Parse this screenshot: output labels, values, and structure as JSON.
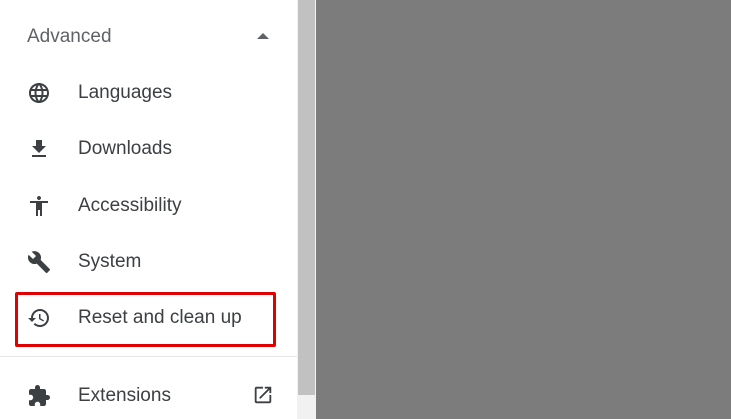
{
  "sidebar": {
    "section": {
      "title": "Advanced",
      "expanded": true,
      "arrow_icon": "arrow-up-icon"
    },
    "items": [
      {
        "label": "Languages",
        "icon": "globe-icon"
      },
      {
        "label": "Downloads",
        "icon": "download-icon"
      },
      {
        "label": "Accessibility",
        "icon": "accessibility-icon"
      },
      {
        "label": "System",
        "icon": "wrench-icon"
      },
      {
        "label": "Reset and clean up",
        "icon": "history-icon",
        "highlighted": true
      },
      {
        "label": "Extensions",
        "icon": "puzzle-icon",
        "external_icon": "open-in-new-icon"
      }
    ]
  },
  "colors": {
    "highlight": "#e00000",
    "overlay": "#7c7c7c",
    "text": "#3c4043",
    "icon": "#3c4043"
  }
}
